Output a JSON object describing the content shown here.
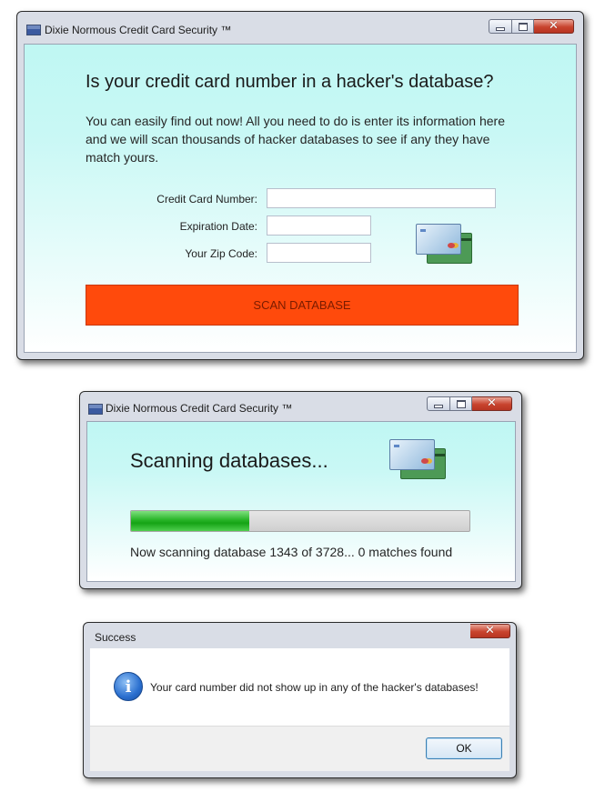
{
  "main_window": {
    "title": "Dixie Normous Credit Card Security ™",
    "heading": "Is your credit card number in a hacker's database?",
    "intro": "You can easily find out now! All you need to do is enter its information here and we will scan thousands of hacker databases to see if any they have match yours.",
    "form": {
      "card_number_label": "Credit Card Number:",
      "card_number_value": "",
      "expiration_label": "Expiration Date:",
      "expiration_value": "",
      "zip_label": "Your Zip Code:",
      "zip_value": ""
    },
    "scan_button": "SCAN DATABASE",
    "icon": "credit-cards-icon"
  },
  "scan_window": {
    "title": "Dixie Normous Credit Card Security ™",
    "heading": "Scanning databases...",
    "progress_percent": 35,
    "status": "Now scanning database 1343 of 3728... 0 matches found",
    "icon": "credit-cards-icon"
  },
  "success_dialog": {
    "title": "Success",
    "message": "Your card number did not show up in any of the hacker's databases!",
    "ok_button": "OK",
    "icon": "info-icon"
  },
  "colors": {
    "scan_button": "#ff4a0c",
    "progress_fill": "#28b428",
    "close_button": "#c8432e",
    "client_bg": "#bff7f3"
  }
}
